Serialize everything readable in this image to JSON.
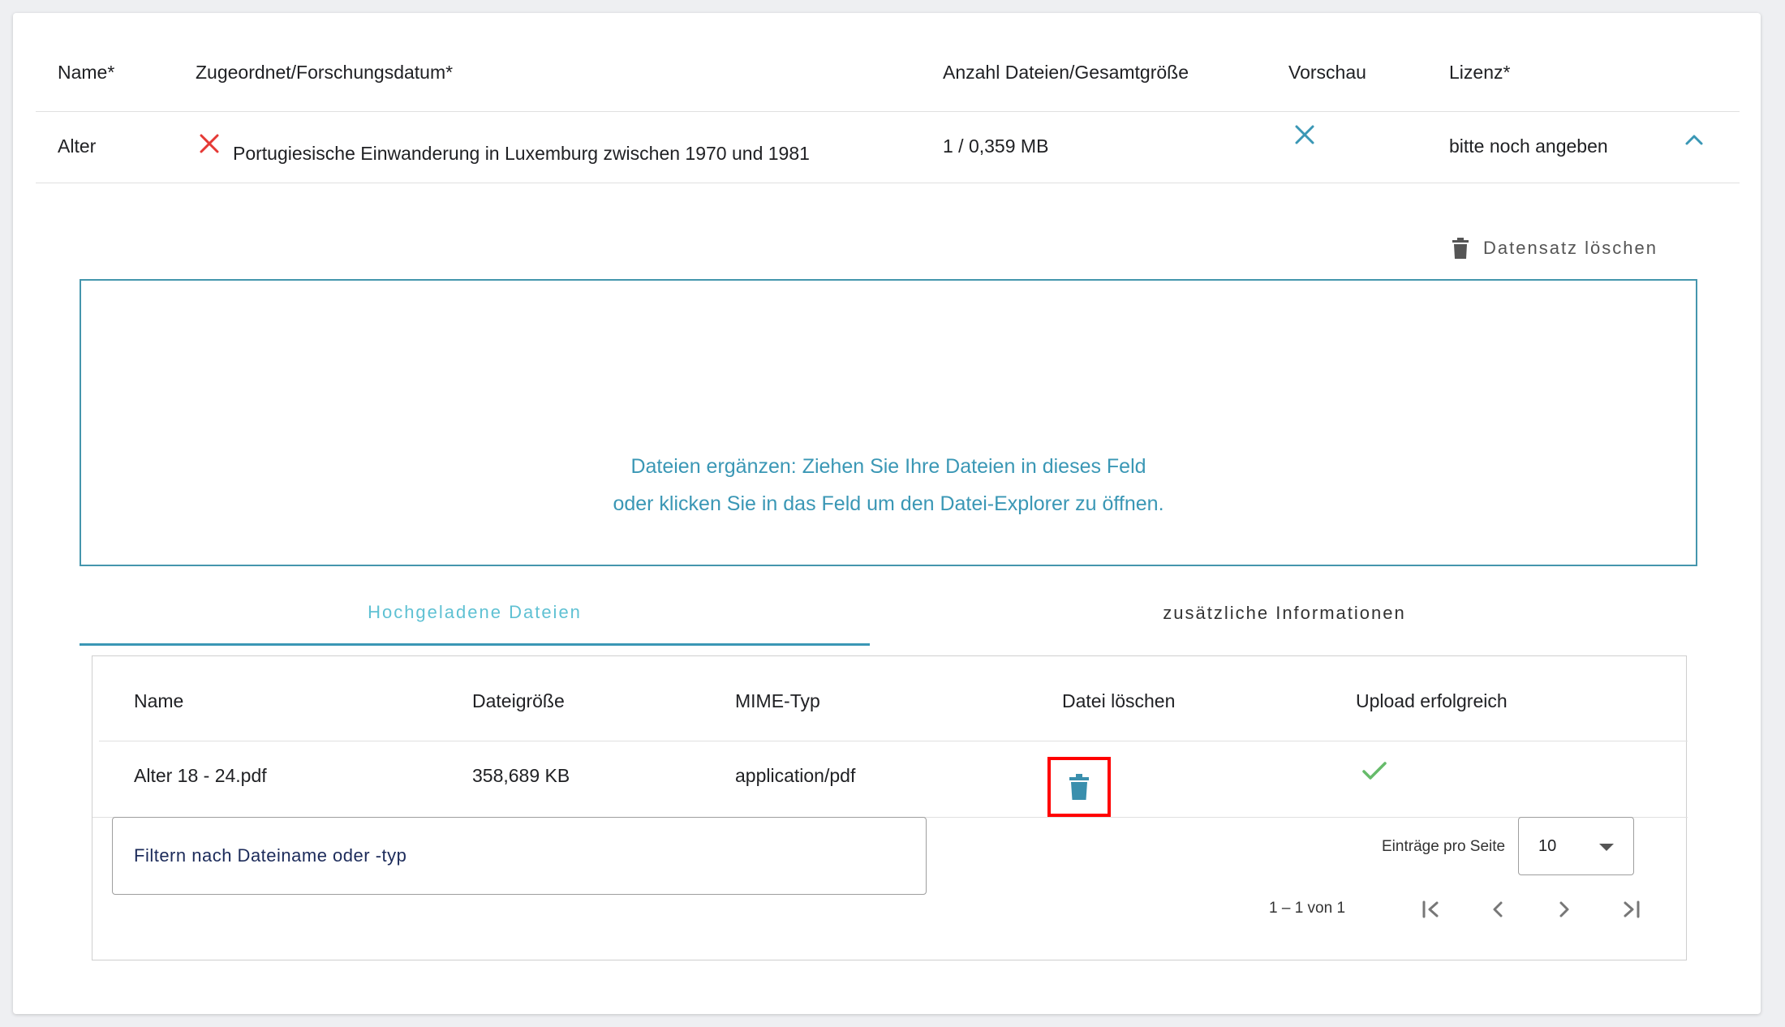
{
  "record_table": {
    "headers": {
      "name": "Name*",
      "assigned": "Zugeordnet/Forschungsdatum*",
      "files": "Anzahl Dateien/Gesamtgröße",
      "preview": "Vorschau",
      "license": "Lizenz*"
    },
    "row": {
      "name": "Alter",
      "assigned_status_icon": "close-icon-red",
      "assigned": "Portugiesische Einwanderung in Luxemburg zwischen 1970 und 1981",
      "files": "1 / 0,359 MB",
      "preview_icon": "close-icon-blue",
      "license": "bitte noch angeben",
      "expand_icon": "chevron-up-icon"
    }
  },
  "delete_record_label": "Datensatz löschen",
  "dropzone": {
    "line1": "Dateien ergänzen: Ziehen Sie Ihre Dateien in dieses Feld",
    "line2": "oder klicken Sie in das Feld um den Datei-Explorer zu öffnen."
  },
  "tabs": [
    {
      "label": "Hochgeladene Dateien",
      "active": true
    },
    {
      "label": "zusätzliche Informationen",
      "active": false
    }
  ],
  "files_table": {
    "headers": {
      "name": "Name",
      "size": "Dateigröße",
      "mime": "MIME-Typ",
      "delete": "Datei löschen",
      "upload": "Upload erfolgreich"
    },
    "rows": [
      {
        "name": "Alter 18 - 24.pdf",
        "size": "358,689 KB",
        "mime": "application/pdf",
        "delete_icon": "trash-icon",
        "upload_icon": "check-icon"
      }
    ],
    "filter_placeholder": "Filtern nach Dateiname oder -typ",
    "per_page_label": "Einträge pro Seite",
    "per_page_value": "10",
    "range_label": "1 – 1 von 1"
  },
  "colors": {
    "accent": "#3a97b5",
    "tab_active_text": "#5fc1d3",
    "error": "#e53935",
    "success": "#66bb6a",
    "highlight_box": "#ff0000"
  }
}
